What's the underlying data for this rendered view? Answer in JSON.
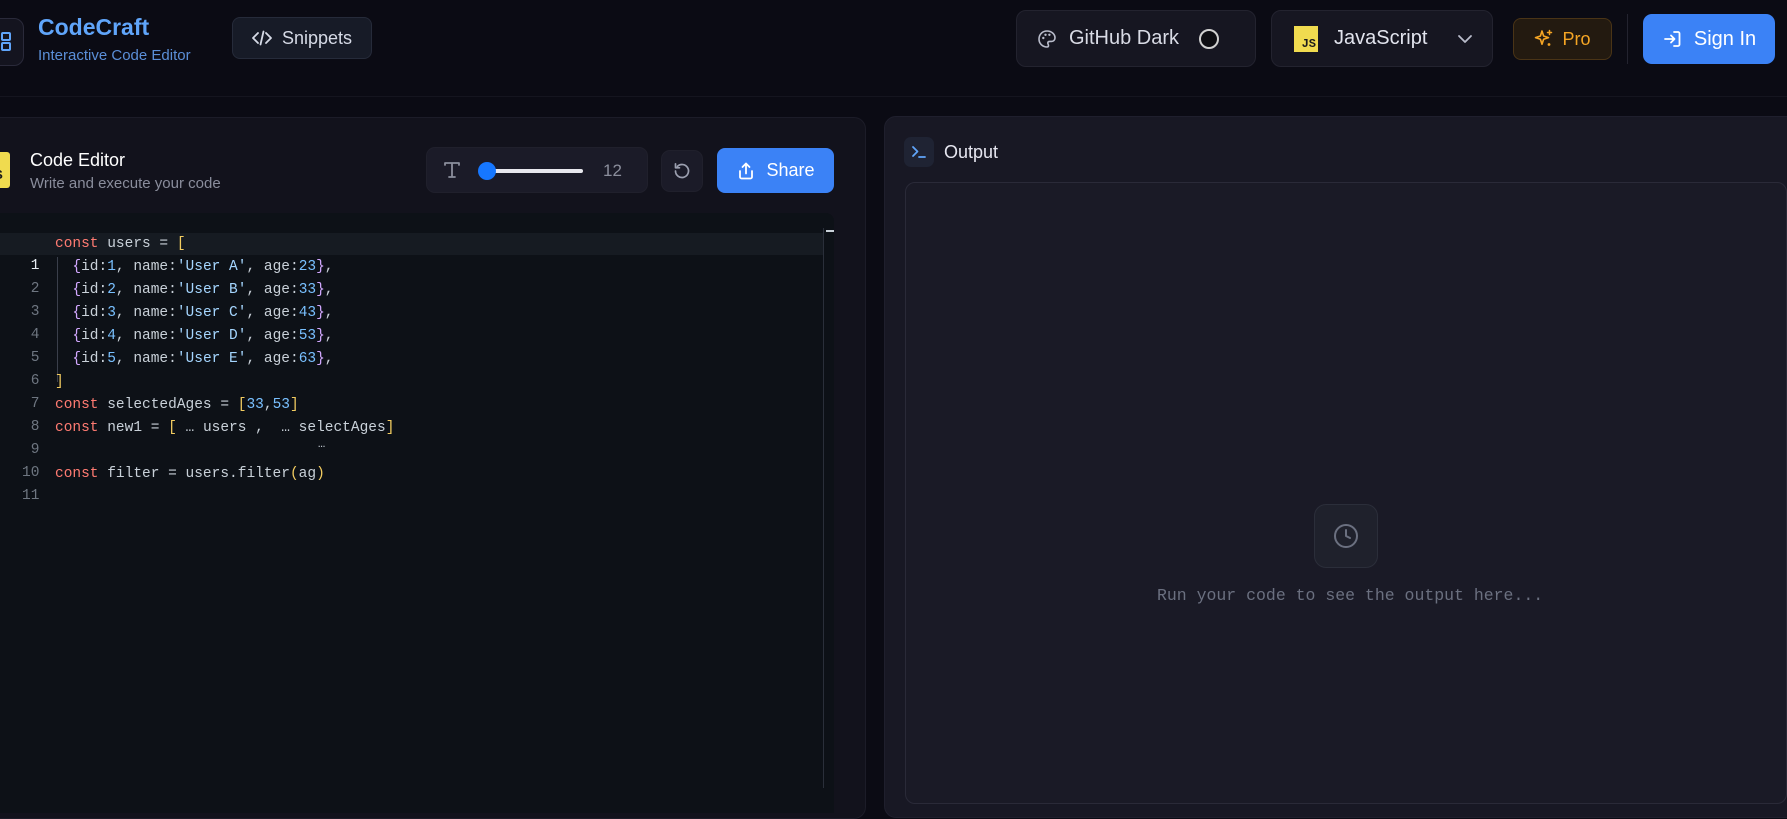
{
  "brand": {
    "name": "CodeCraft",
    "subtitle": "Interactive Code Editor"
  },
  "header": {
    "snippets_label": "Snippets",
    "theme": {
      "selected": "GitHub Dark"
    },
    "language": {
      "badge": "JS",
      "selected": "JavaScript"
    },
    "pro_label": "Pro",
    "signin_label": "Sign In"
  },
  "editor": {
    "badge": "JS",
    "title": "Code Editor",
    "subtitle": "Write and execute your code",
    "font_size": "12",
    "font_size_range": {
      "min": 12,
      "max": 24,
      "value": 12
    },
    "share_label": "Share",
    "active_line": 1,
    "lines": [
      {
        "num": "1"
      },
      {
        "num": "2"
      },
      {
        "num": "3"
      },
      {
        "num": "4"
      },
      {
        "num": "5"
      },
      {
        "num": "6"
      },
      {
        "num": "7"
      },
      {
        "num": "8"
      },
      {
        "num": "9"
      },
      {
        "num": "10"
      },
      {
        "num": "11"
      }
    ],
    "code": {
      "l1": [
        "const",
        " users = ",
        "["
      ],
      "l2": [
        "  ",
        "{",
        "id:",
        "1",
        ", name:",
        "'User A'",
        ", age:",
        "23",
        "}",
        ","
      ],
      "l3": [
        "  ",
        "{",
        "id:",
        "2",
        ", name:",
        "'User B'",
        ", age:",
        "33",
        "}",
        ","
      ],
      "l4": [
        "  ",
        "{",
        "id:",
        "3",
        ", name:",
        "'User C'",
        ", age:",
        "43",
        "}",
        ","
      ],
      "l5": [
        "  ",
        "{",
        "id:",
        "4",
        ", name:",
        "'User D'",
        ", age:",
        "53",
        "}",
        ","
      ],
      "l6": [
        "  ",
        "{",
        "id:",
        "5",
        ", name:",
        "'User E'",
        ", age:",
        "63",
        "}",
        ","
      ],
      "l7": [
        "]"
      ],
      "l8": [
        "const",
        " selectedAges = ",
        "[",
        "33",
        ",",
        "53",
        "]"
      ],
      "l9": [
        "const",
        " new1 = ",
        "[",
        " … users ,  … selectAges",
        "]"
      ],
      "l11": [
        "const",
        " filter = users.filter",
        "(",
        "ag",
        ")"
      ],
      "ghost_dots": "…"
    }
  },
  "output": {
    "title": "Output",
    "placeholder": "Run your code to see the output here..."
  },
  "colors": {
    "accent": "#3b82f6",
    "pro": "#f5a524",
    "keyword": "#ff7b72",
    "number": "#79c0ff",
    "string": "#a5d6ff"
  }
}
